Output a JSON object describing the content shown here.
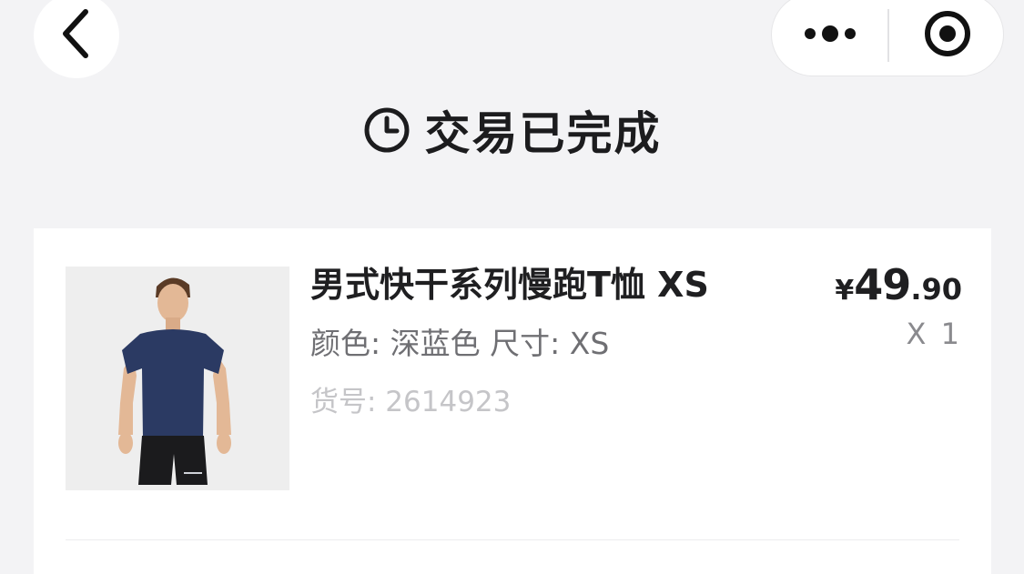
{
  "nav": {
    "back_icon": "chevron-left-icon",
    "more_icon": "more-dots-icon",
    "close_icon": "target-close-icon"
  },
  "status": {
    "icon": "clock-icon",
    "text": "交易已完成"
  },
  "product": {
    "title": "男式快干系列慢跑T恤 XS",
    "spec_text": "颜色: 深蓝色  尺寸: XS",
    "sku_text": "货号: 2614923",
    "price_currency": "¥",
    "price_int": "49",
    "price_dec": ".90",
    "quantity": "X 1"
  },
  "colors": {
    "background": "#f3f3f5",
    "card": "#ffffff",
    "shirt": "#2b3a63",
    "text_primary": "#1f1f21",
    "text_secondary": "#6f6f73",
    "text_muted": "#c5c5c8"
  }
}
